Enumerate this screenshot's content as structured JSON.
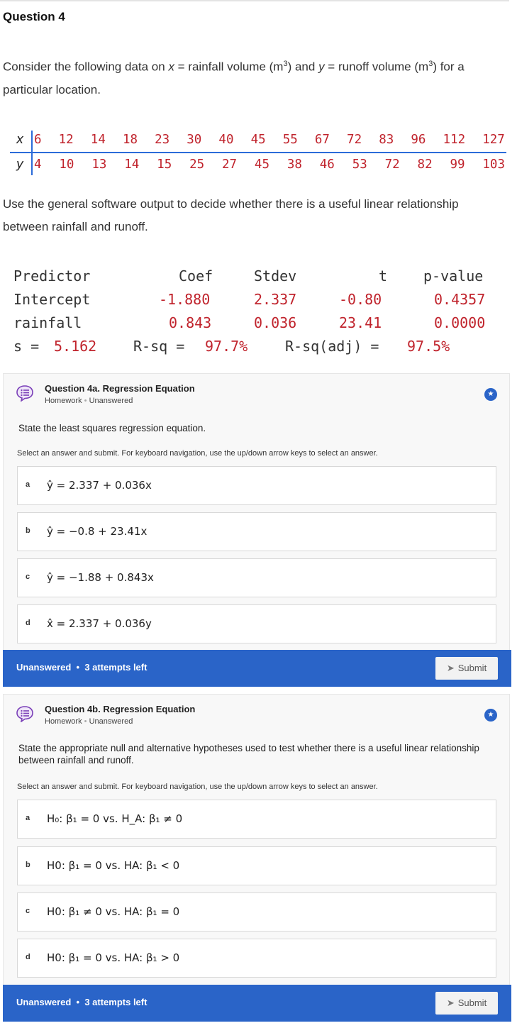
{
  "question": {
    "title": "Question 4",
    "intro_a": "Consider the following data on ",
    "intro_x": "x",
    "intro_b": " = rainfall volume (m",
    "intro_sup1": "3",
    "intro_c": ") and ",
    "intro_y": "y",
    "intro_d": " = runoff volume (m",
    "intro_sup2": "3",
    "intro_e": ") for a particular location."
  },
  "data_table": {
    "x_label": "x",
    "y_label": "y",
    "x": [
      "6",
      "12",
      "14",
      "18",
      "23",
      "30",
      "40",
      "45",
      "55",
      "67",
      "72",
      "83",
      "96",
      "112",
      "127"
    ],
    "y": [
      "4",
      "10",
      "13",
      "14",
      "15",
      "25",
      "27",
      "45",
      "38",
      "46",
      "53",
      "72",
      "82",
      "99",
      "103"
    ]
  },
  "instruction": "Use the general software output to decide whether there is a useful linear relationship between rainfall and runoff.",
  "output": {
    "h_predictor": "Predictor",
    "h_coef": "Coef",
    "h_stdev": "Stdev",
    "h_t": "t",
    "h_pvalue": "p-value",
    "r1_name": "Intercept",
    "r1_coef": "-1.880",
    "r1_stdev": "2.337",
    "r1_t": "-0.80",
    "r1_p": "0.4357",
    "r2_name": "rainfall",
    "r2_coef": "0.843",
    "r2_stdev": "0.036",
    "r2_t": "23.41",
    "r2_p": "0.0000",
    "s_label": "s =",
    "s_val": "5.162",
    "rsq_label": "R-sq =",
    "rsq_val": "97.7%",
    "rsqadj_label": "R-sq(adj) =",
    "rsqadj_val": "97.5%"
  },
  "q4a": {
    "title": "Question 4a. Regression Equation",
    "type": "Homework",
    "status": "Unanswered",
    "prompt": "State the least squares regression equation.",
    "instructions": "Select an answer and submit. For keyboard navigation, use the up/down arrow keys to select an answer.",
    "options": [
      {
        "letter": "a",
        "text": "ŷ = 2.337 + 0.036x"
      },
      {
        "letter": "b",
        "text": "ŷ = −0.8 + 23.41x"
      },
      {
        "letter": "c",
        "text": "ŷ = −1.88 + 0.843x"
      },
      {
        "letter": "d",
        "text": "x̂ = 2.337 + 0.036y"
      }
    ],
    "footer_status": "Unanswered",
    "attempts": "3 attempts left",
    "submit": "Submit"
  },
  "q4b": {
    "title": "Question 4b. Regression Equation",
    "type": "Homework",
    "status": "Unanswered",
    "prompt": "State the appropriate null and alternative hypotheses used to test whether there is a useful linear relationship between rainfall and runoff.",
    "instructions": "Select an answer and submit. For keyboard navigation, use the up/down arrow keys to select an answer.",
    "options": [
      {
        "letter": "a",
        "text": "H₀: β₁ = 0 vs. H_A: β₁ ≠ 0"
      },
      {
        "letter": "b",
        "text": "H0: β₁ = 0 vs. HA: β₁ < 0"
      },
      {
        "letter": "c",
        "text": "H0: β₁ ≠ 0 vs. HA: β₁ = 0"
      },
      {
        "letter": "d",
        "text": "H0: β₁ = 0 vs. HA: β₁ > 0"
      }
    ],
    "footer_status": "Unanswered",
    "attempts": "3 attempts left",
    "submit": "Submit"
  },
  "colors": {
    "accent": "#2a64c8",
    "table_value": "#c0232c",
    "table_rule": "#2b6bd9"
  },
  "icons": [
    "question-bubble-icon",
    "star-badge-icon",
    "paper-plane-icon"
  ]
}
